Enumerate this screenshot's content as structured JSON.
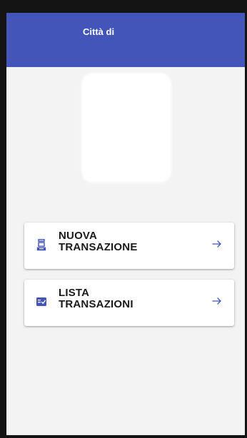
{
  "app_bar": {
    "title": "Città di ",
    "color": "#4355b8"
  },
  "menu": {
    "items": [
      {
        "line1": "NUOVA",
        "line2": "TRANSAZIONE",
        "icon": "cash-register-icon",
        "action_icon": "arrow-right-icon"
      },
      {
        "line1": "LISTA",
        "line2": "TRANSAZIONI",
        "icon": "receipt-list-icon",
        "action_icon": "arrow-right-icon"
      }
    ]
  },
  "colors": {
    "primary": "#4355b8",
    "background": "#f3f3f3",
    "card": "#ffffff",
    "text": "#1a1a1a"
  }
}
